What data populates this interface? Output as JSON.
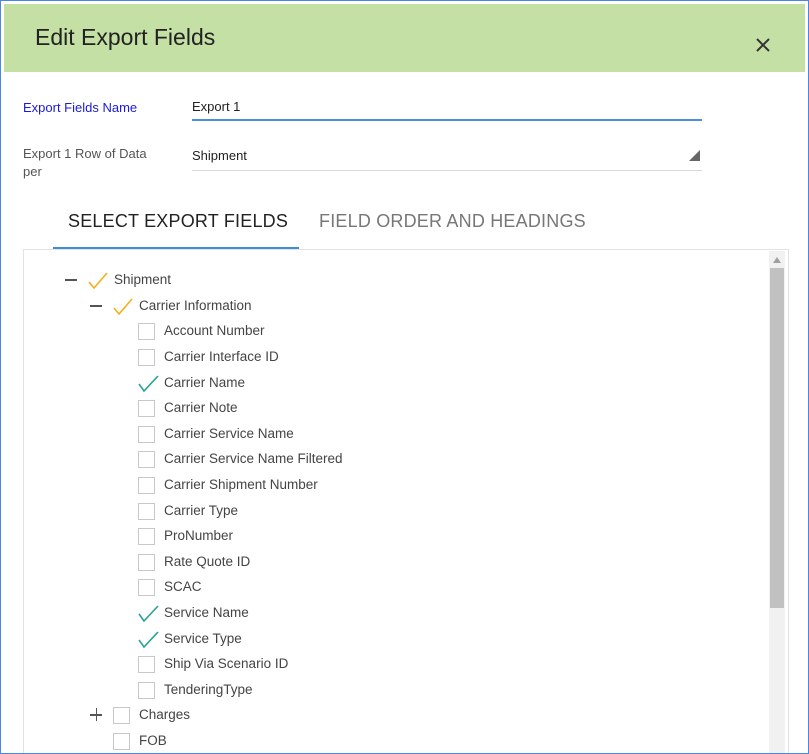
{
  "dialog": {
    "title": "Edit Export Fields",
    "close_icon": "close-icon"
  },
  "form": {
    "name_label": "Export Fields Name",
    "name_value": "Export 1",
    "row_label": "Export 1 Row of Data per",
    "row_value": "Shipment"
  },
  "tabs": [
    {
      "label": "SELECT EXPORT FIELDS",
      "active": true
    },
    {
      "label": "FIELD ORDER AND HEADINGS",
      "active": false
    }
  ],
  "colors": {
    "header_bg": "#c5e0a5",
    "partial_check": "#f2b01e",
    "full_check": "#2aa198",
    "accent": "#3b8fd8",
    "label_link": "#1a1adb"
  },
  "tree": {
    "root": {
      "label": "Shipment",
      "state": "partial",
      "expanded": true
    },
    "carrier": {
      "label": "Carrier Information",
      "state": "partial",
      "expanded": true
    },
    "fields": [
      {
        "label": "Account Number",
        "checked": false
      },
      {
        "label": "Carrier Interface ID",
        "checked": false
      },
      {
        "label": "Carrier Name",
        "checked": true
      },
      {
        "label": "Carrier Note",
        "checked": false
      },
      {
        "label": "Carrier Service Name",
        "checked": false
      },
      {
        "label": "Carrier Service Name Filtered",
        "checked": false
      },
      {
        "label": "Carrier Shipment Number",
        "checked": false
      },
      {
        "label": "Carrier Type",
        "checked": false
      },
      {
        "label": "ProNumber",
        "checked": false
      },
      {
        "label": "Rate Quote ID",
        "checked": false
      },
      {
        "label": "SCAC",
        "checked": false
      },
      {
        "label": "Service Name",
        "checked": true
      },
      {
        "label": "Service Type",
        "checked": true
      },
      {
        "label": "Ship Via Scenario ID",
        "checked": false
      },
      {
        "label": "TenderingType",
        "checked": false
      }
    ],
    "charges": {
      "label": "Charges",
      "state": "unchecked",
      "expanded": false
    },
    "fob": {
      "label": "FOB",
      "state": "unchecked"
    }
  }
}
